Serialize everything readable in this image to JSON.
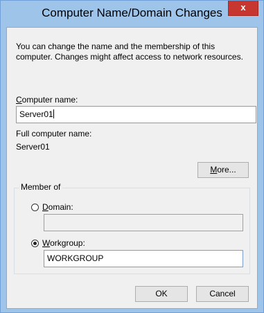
{
  "window": {
    "title": "Computer Name/Domain Changes",
    "close_glyph": "x"
  },
  "description": "You can change the name and the membership of this computer. Changes might affect access to network resources.",
  "computer_name": {
    "label_accel": "C",
    "label_rest": "omputer name:",
    "value": "Server01"
  },
  "full_name": {
    "label": "Full computer name:",
    "value": "Server01"
  },
  "more_button": {
    "label_accel": "M",
    "label_rest": "ore..."
  },
  "member_of": {
    "legend": "Member of",
    "domain": {
      "label_accel": "D",
      "label_rest": "omain:",
      "value": "",
      "selected": false
    },
    "workgroup": {
      "label_accel": "W",
      "label_rest": "orkgroup:",
      "value": "WORKGROUP",
      "selected": true
    }
  },
  "buttons": {
    "ok": "OK",
    "cancel": "Cancel"
  },
  "colors": {
    "frame": "#9ec4ea",
    "close": "#c7372f",
    "client": "#f0f0f0"
  }
}
